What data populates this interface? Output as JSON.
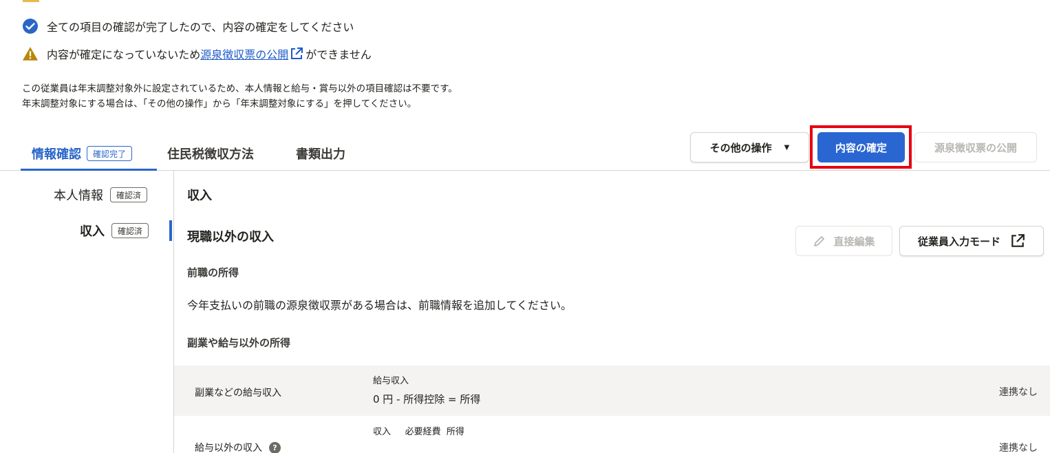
{
  "messages": {
    "complete": "全ての項目の確認が完了したので、内容の確定をしてください",
    "warn_prefix": "内容が確定になっていないため",
    "warn_link": "源泉徴収票の公開",
    "warn_suffix": "ができません"
  },
  "note": {
    "line1": "この従業員は年末調整対象外に設定されているため、本人情報と給与・賞与以外の項目確認は不要です。",
    "line2": "年末調整対象にする場合は、「その他の操作」から「年末調整対象にする」を押してください。"
  },
  "tabs": [
    {
      "label": "情報確認",
      "badge": "確認完了",
      "active": true
    },
    {
      "label": "住民税徴収方法"
    },
    {
      "label": "書類出力"
    }
  ],
  "actions": {
    "other": "その他の操作",
    "confirm": "内容の確定",
    "publish": "源泉徴収票の公開"
  },
  "sidebar": {
    "items": [
      {
        "label": "本人情報",
        "tag": "確認済"
      },
      {
        "label": "収入",
        "tag": "確認済",
        "selected": true
      }
    ]
  },
  "main": {
    "title": "収入",
    "section_title": "現職以外の収入",
    "edit_button": "直接編集",
    "mode_button": "従業員入力モード",
    "prev_label": "前職の所得",
    "prev_text": "今年支払いの前職の源泉徴収票がある場合は、前職情報を追加してください。",
    "side_label": "副業や給与以外の所得",
    "rows": [
      {
        "name": "副業などの給与収入",
        "sub": "給与収入",
        "formula": "0 円  -  所得控除  =  所得",
        "status": "連携なし"
      },
      {
        "name": "給与以外の収入",
        "sub": "収入     必要経費  所得",
        "status": "連携なし"
      }
    ]
  },
  "colors": {
    "accent": "#2a66c9",
    "primary_button": "#2a66d2",
    "highlight": "#e60012",
    "warning": "#b8860b"
  }
}
